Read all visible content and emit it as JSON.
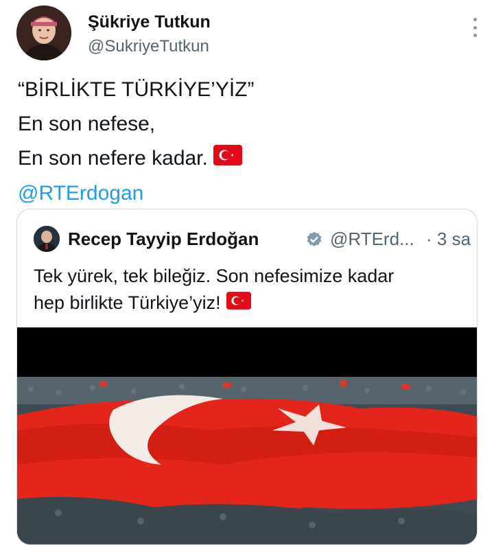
{
  "author": {
    "name": "Şükriye Tutkun",
    "handle": "@SukriyeTutkun"
  },
  "tweet": {
    "line1": "“BİRLİKTE TÜRKİYE’YİZ”",
    "line2": "En son nefese,",
    "line3": "En son nefere kadar.",
    "mention": "@RTErdogan",
    "emoji": "turkish-flag-emoji"
  },
  "quoted_tweet": {
    "name": "Recep Tayyip Erdoğan",
    "verified": true,
    "handle": "@RTErd...",
    "time": "· 3 sa",
    "line1": "Tek yürek, tek bileğiz. Son nefesimize kadar",
    "line2": "hep birlikte Türkiye’yiz!",
    "emoji": "turkish-flag-emoji",
    "media": "crowd-with-giant-turkish-flag-image"
  },
  "colors": {
    "link": "#1d9bf0",
    "secondary_text": "#536471",
    "primary_text": "#0f1419",
    "border": "#cfd9de",
    "flag_red": "#e30a17"
  },
  "icons": [
    "more-options-icon",
    "verified-badge-icon"
  ]
}
